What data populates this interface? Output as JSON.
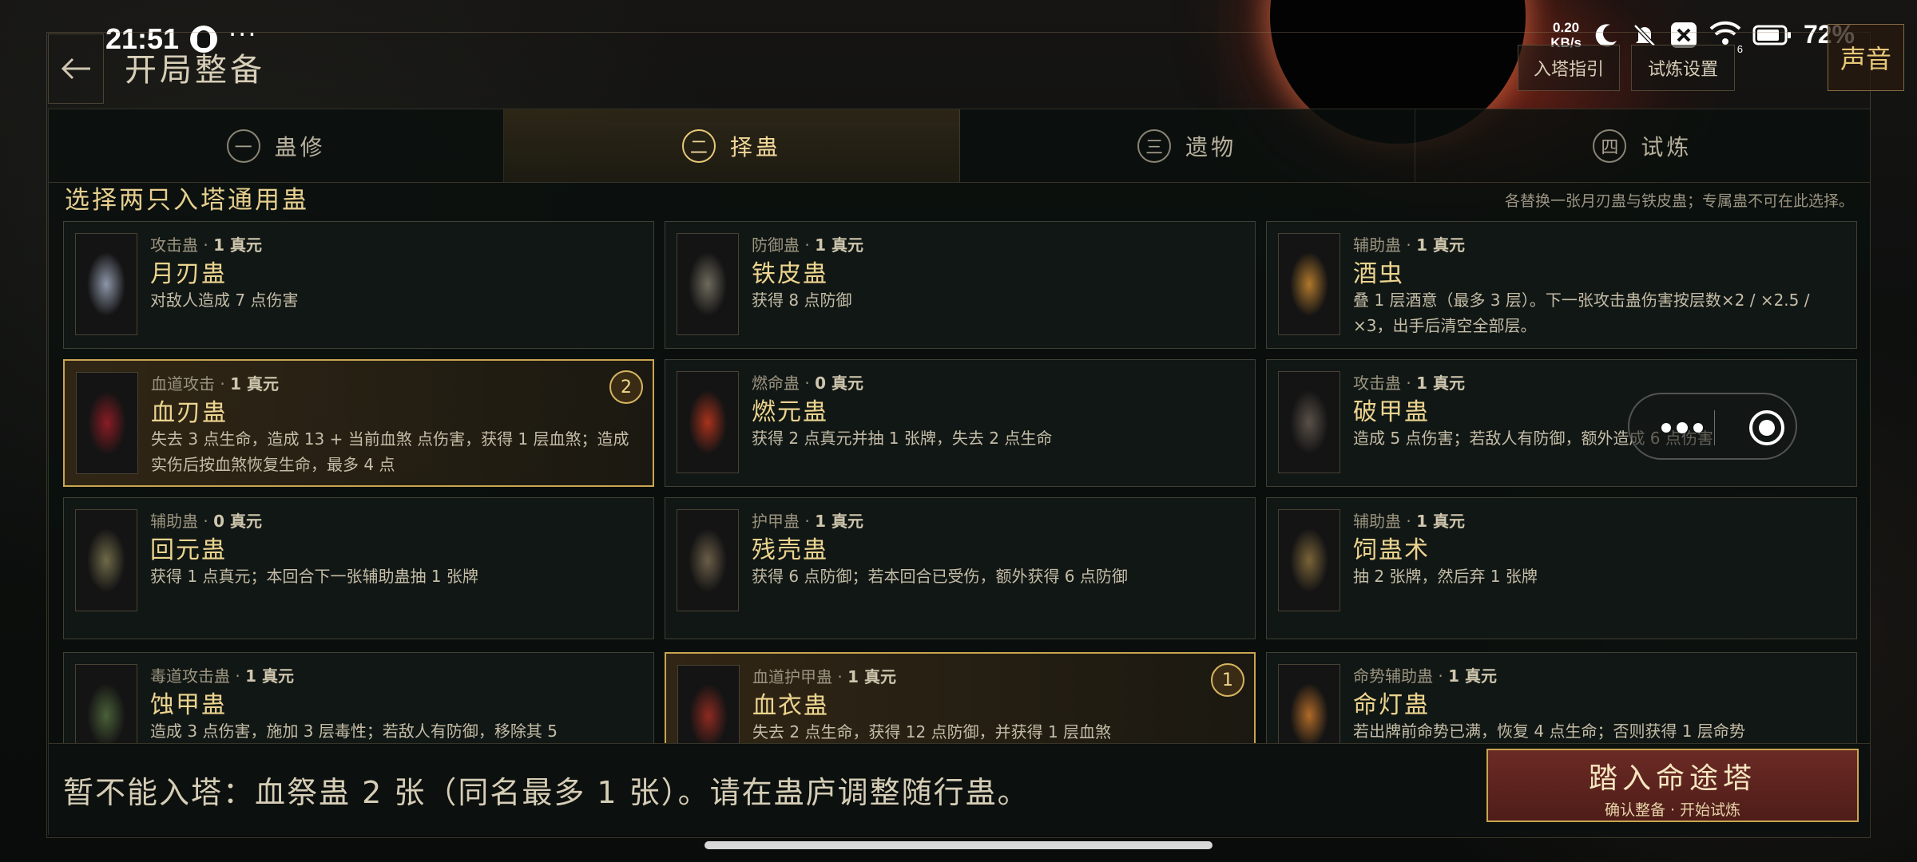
{
  "status_bar": {
    "time": "21:51",
    "dots": "···",
    "net_speed_value": "0.20",
    "net_speed_unit": "KB/s",
    "signal_sub": "6",
    "battery": "72%"
  },
  "header": {
    "title": "开局整备",
    "guide_button": "入塔指引",
    "settings_button": "试炼设置",
    "sound_button": "声音"
  },
  "tabs": [
    {
      "num": "一",
      "label": "蛊修",
      "active": false
    },
    {
      "num": "二",
      "label": "择蛊",
      "active": true
    },
    {
      "num": "三",
      "label": "遗物",
      "active": false
    },
    {
      "num": "四",
      "label": "试炼",
      "active": false
    }
  ],
  "section": {
    "title": "选择两只入塔通用蛊",
    "note": "各替换一张月刃蛊与铁皮蛊；专属蛊不可在此选择。"
  },
  "cards": [
    {
      "type": "攻击蛊 · ",
      "cost": "1 真元",
      "name": "月刃蛊",
      "desc": "对敌人造成 7 点伤害",
      "selected": false,
      "badge": "",
      "art": "#8d96a8"
    },
    {
      "type": "防御蛊 · ",
      "cost": "1 真元",
      "name": "铁皮蛊",
      "desc": "获得 8 点防御",
      "selected": false,
      "badge": "",
      "art": "#6e6a5c"
    },
    {
      "type": "辅助蛊 · ",
      "cost": "1 真元",
      "name": "酒虫",
      "desc": "叠 1 层酒意（最多 3 层）。下一张攻击蛊伤害按层数×2 / ×2.5 / ×3，出手后清空全部层。",
      "selected": false,
      "badge": "",
      "art": "#b0782c"
    },
    {
      "type": "血道攻击 · ",
      "cost": "1 真元",
      "name": "血刃蛊",
      "desc": "失去 3 点生命，造成 13 + 当前血煞 点伤害，获得 1 层血煞；造成实伤后按血煞恢复生命，最多 4 点",
      "selected": true,
      "badge": "2",
      "art": "#8a1c24"
    },
    {
      "type": "燃命蛊 · ",
      "cost": "0 真元",
      "name": "燃元蛊",
      "desc": "获得 2 点真元并抽 1 张牌，失去 2 点生命",
      "selected": false,
      "badge": "",
      "art": "#a8321c"
    },
    {
      "type": "攻击蛊 · ",
      "cost": "1 真元",
      "name": "破甲蛊",
      "desc": "造成 5 点伤害；若敌人有防御，额外造成 6 点伤害",
      "selected": false,
      "badge": "",
      "art": "#5a5048"
    },
    {
      "type": "辅助蛊 · ",
      "cost": "0 真元",
      "name": "回元蛊",
      "desc": "获得 1 点真元；本回合下一张辅助蛊抽 1 张牌",
      "selected": false,
      "badge": "",
      "art": "#6f6a48"
    },
    {
      "type": "护甲蛊 · ",
      "cost": "1 真元",
      "name": "残壳蛊",
      "desc": "获得 6 点防御；若本回合已受伤，额外获得 6 点防御",
      "selected": false,
      "badge": "",
      "art": "#6b5e48"
    },
    {
      "type": "辅助蛊 · ",
      "cost": "1 真元",
      "name": "饲蛊术",
      "desc": "抽 2 张牌，然后弃 1 张牌",
      "selected": false,
      "badge": "",
      "art": "#7a6438"
    },
    {
      "type": "毒道攻击蛊 · ",
      "cost": "1 真元",
      "name": "蚀甲蛊",
      "desc": "造成 3 点伤害，施加 3 层毒性；若敌人有防御，移除其 5",
      "selected": false,
      "badge": "",
      "art": "#4a6038"
    },
    {
      "type": "血道护甲蛊 · ",
      "cost": "1 真元",
      "name": "血衣蛊",
      "desc": "失去 2 点生命，获得 12 点防御，并获得 1 层血煞",
      "selected": true,
      "badge": "1",
      "art": "#8e2a20"
    },
    {
      "type": "命势辅助蛊 · ",
      "cost": "1 真元",
      "name": "命灯蛊",
      "desc": "若出牌前命势已满，恢复 4 点生命；否则获得 1 层命势",
      "selected": false,
      "badge": "",
      "art": "#b06a28"
    }
  ],
  "bottom": {
    "warning": "暂不能入塔：血祭蛊 2 张（同名最多 1 张）。请在蛊庐调整随行蛊。",
    "enter_main": "踏入命途塔",
    "enter_sub": "确认整备 · 开始试炼"
  }
}
